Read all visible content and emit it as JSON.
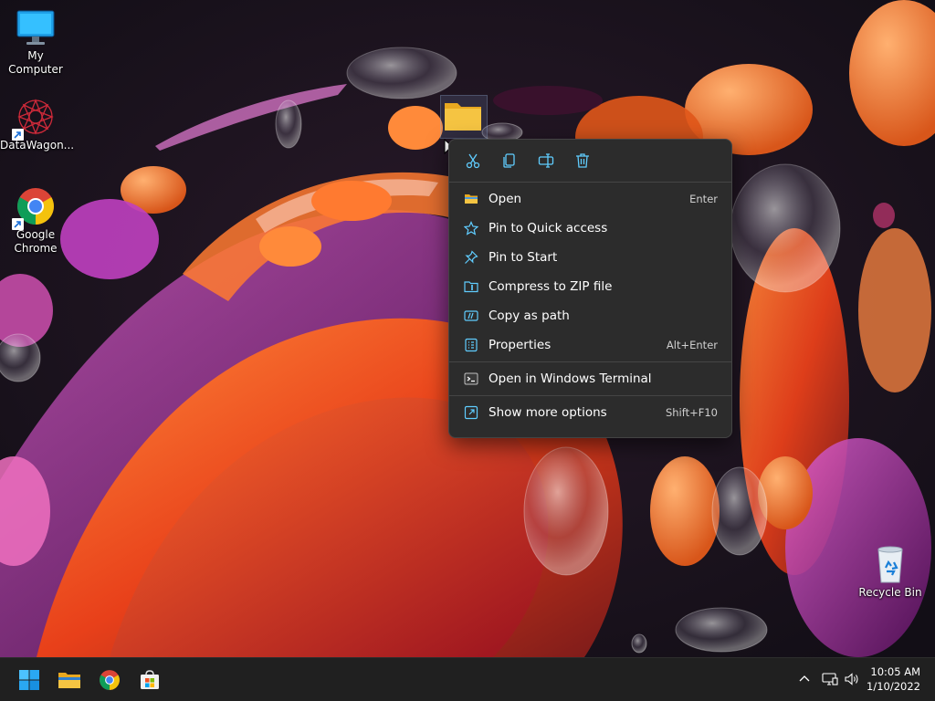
{
  "desktop": {
    "icons": [
      {
        "label": "My Computer"
      },
      {
        "label": "DataWagon..."
      },
      {
        "label": "Google Chrome"
      },
      {
        "label": "Recycle Bin"
      }
    ]
  },
  "context_menu": {
    "quick_actions": [
      {
        "icon": "cut-icon"
      },
      {
        "icon": "copy-icon"
      },
      {
        "icon": "rename-icon"
      },
      {
        "icon": "delete-icon"
      }
    ],
    "items": [
      {
        "label": "Open",
        "shortcut": "Enter",
        "icon": "folder-icon"
      },
      {
        "label": "Pin to Quick access",
        "shortcut": "",
        "icon": "star-icon"
      },
      {
        "label": "Pin to Start",
        "shortcut": "",
        "icon": "pin-icon"
      },
      {
        "label": "Compress to ZIP file",
        "shortcut": "",
        "icon": "zip-icon"
      },
      {
        "label": "Copy as path",
        "shortcut": "",
        "icon": "copy-path-icon"
      },
      {
        "label": "Properties",
        "shortcut": "Alt+Enter",
        "icon": "properties-icon"
      },
      {
        "label": "Open in Windows Terminal",
        "shortcut": "",
        "icon": "terminal-icon"
      },
      {
        "label": "Show more options",
        "shortcut": "Shift+F10",
        "icon": "more-options-icon"
      }
    ]
  },
  "taskbar": {
    "apps": [
      "start-icon",
      "file-explorer-icon",
      "chrome-icon",
      "store-icon"
    ],
    "tray": [
      "chevron-up-icon",
      "network-icon",
      "volume-icon"
    ],
    "clock": {
      "time": "10:05 AM",
      "date": "1/10/2022"
    }
  },
  "colors": {
    "menu_bg": "#2c2c2c",
    "accent_blue": "#60cdff",
    "taskbar_bg": "#202020",
    "folder_yellow": "#f5c442"
  }
}
